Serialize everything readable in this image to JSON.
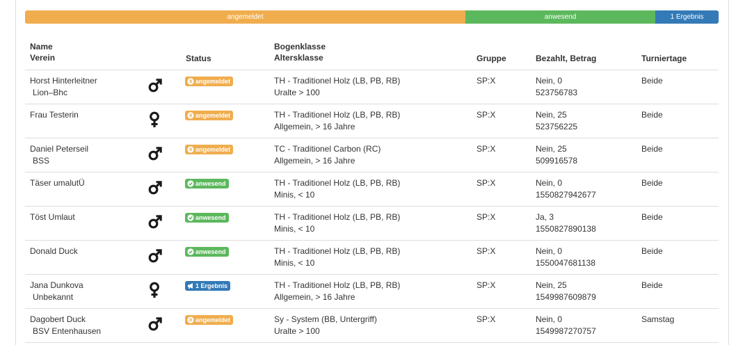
{
  "progress": {
    "registered": "angemeldet",
    "present": "anwesend",
    "result": "1 Ergebnis"
  },
  "headers": {
    "name": "Name",
    "verein": "Verein",
    "status": "Status",
    "bogenklasse": "Bogenklasse",
    "altersklasse": "Altersklasse",
    "gruppe": "Gruppe",
    "bezahlt": "Bezahlt, Betrag",
    "turniertage": "Turniertage"
  },
  "colors": {
    "registered": "#f0ad4e",
    "present": "#5cb85c",
    "result": "#337ab7"
  },
  "rows": [
    {
      "name": "Horst Hinterleitner",
      "verein": "Lion–Bhc",
      "gender": "male-icon",
      "status": "angemeldet",
      "status_type": "warning",
      "bogen": "TH - Traditionel Holz (LB, PB, RB)",
      "alter": "Uralte > 100",
      "gruppe": "SP:X",
      "bezahlt": "Nein, 0",
      "betrag": "523756783",
      "tage": "Beide"
    },
    {
      "name": "Frau Testerin",
      "verein": "",
      "gender": "female-icon",
      "status": "angemeldet",
      "status_type": "warning",
      "bogen": "TH - Traditionel Holz (LB, PB, RB)",
      "alter": "Allgemein, > 16 Jahre",
      "gruppe": "SP:X",
      "bezahlt": "Nein, 25",
      "betrag": "523756225",
      "tage": "Beide"
    },
    {
      "name": "Daniel Peterseil",
      "verein": "BSS",
      "gender": "male-icon",
      "status": "angemeldet",
      "status_type": "warning",
      "bogen": "TC - Traditionel Carbon (RC)",
      "alter": "Allgemein, > 16 Jahre",
      "gruppe": "SP:X",
      "bezahlt": "Nein, 25",
      "betrag": "509916578",
      "tage": "Beide"
    },
    {
      "name": "Täser umalutÜ",
      "verein": "",
      "gender": "male-icon",
      "status": "anwesend",
      "status_type": "success",
      "bogen": "TH - Traditionel Holz (LB, PB, RB)",
      "alter": "Minis, < 10",
      "gruppe": "SP:X",
      "bezahlt": "Nein, 0",
      "betrag": "1550827942677",
      "tage": "Beide"
    },
    {
      "name": "Töst Umlaut",
      "verein": "",
      "gender": "male-icon",
      "status": "anwesend",
      "status_type": "success",
      "bogen": "TH - Traditionel Holz (LB, PB, RB)",
      "alter": "Minis, < 10",
      "gruppe": "SP:X",
      "bezahlt": "Ja, 3",
      "betrag": "1550827890138",
      "tage": "Beide"
    },
    {
      "name": "Donald Duck",
      "verein": "",
      "gender": "male-icon",
      "status": "anwesend",
      "status_type": "success",
      "bogen": "TH - Traditionel Holz (LB, PB, RB)",
      "alter": "Minis, < 10",
      "gruppe": "SP:X",
      "bezahlt": "Nein, 0",
      "betrag": "1550047681138",
      "tage": "Beide"
    },
    {
      "name": "Jana Dunkova",
      "verein": "Unbekannt",
      "gender": "female-icon",
      "status": "1 Ergebnis",
      "status_type": "primary",
      "bogen": "TH - Traditionel Holz (LB, PB, RB)",
      "alter": "Allgemein, > 16 Jahre",
      "gruppe": "SP:X",
      "bezahlt": "Nein, 25",
      "betrag": "1549987609879",
      "tage": "Beide"
    },
    {
      "name": "Dagobert Duck",
      "verein": "BSV Entenhausen",
      "gender": "male-icon",
      "status": "angemeldet",
      "status_type": "warning",
      "bogen": "Sy - System (BB, Untergriff)",
      "alter": "Uralte > 100",
      "gruppe": "SP:X",
      "bezahlt": "Nein, 0",
      "betrag": "1549987270757",
      "tage": "Samstag"
    }
  ]
}
